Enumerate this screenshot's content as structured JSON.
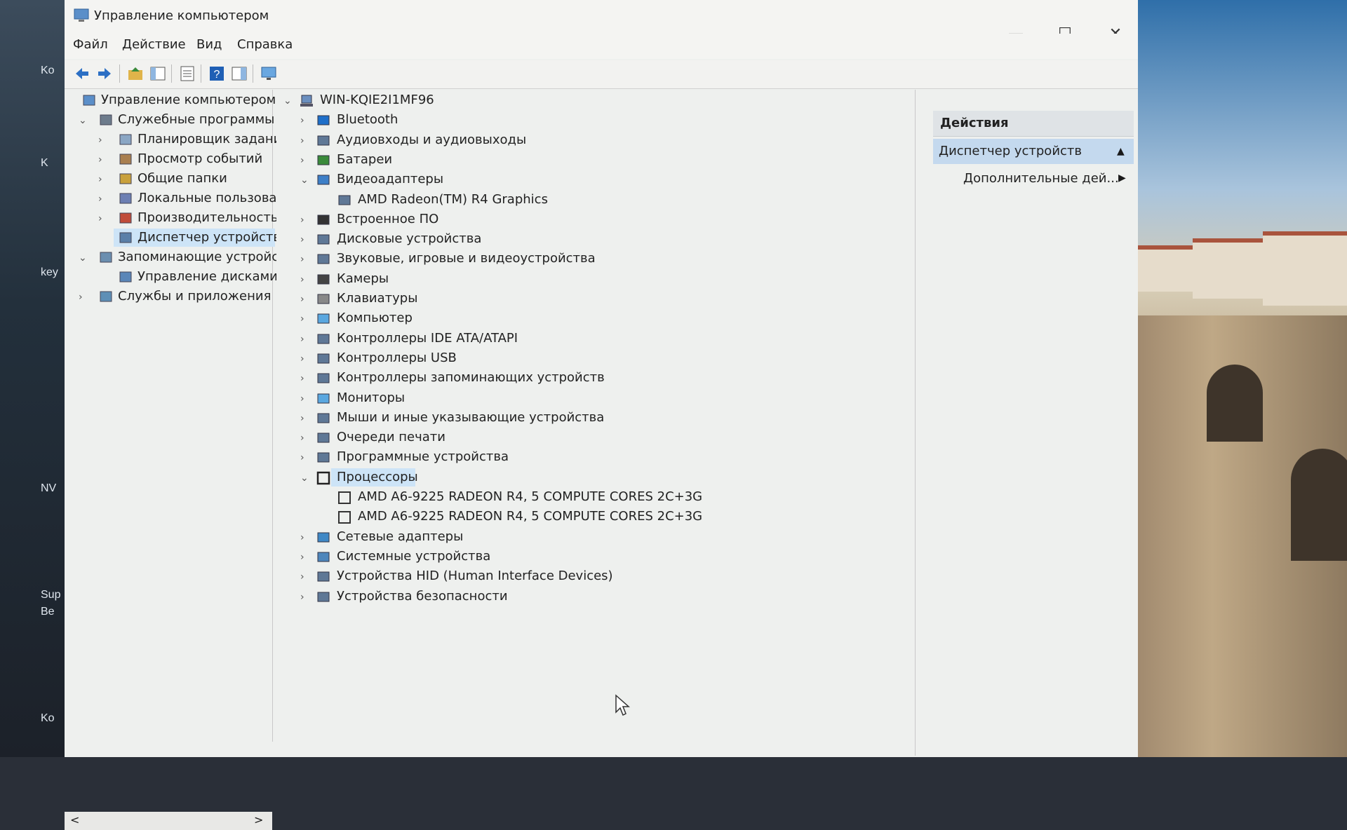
{
  "window": {
    "title": "Управление компьютером",
    "minimize": "—",
    "maximize": "☐",
    "close": "✕"
  },
  "menu": [
    "Файл",
    "Действие",
    "Вид",
    "Справка"
  ],
  "desktop_labels": [
    "Ko",
    "K",
    "key",
    "NV",
    "Sup",
    "Be",
    "Ko"
  ],
  "left_tree": [
    {
      "label": "Управление компьютером (л",
      "level": 0,
      "chev": ""
    },
    {
      "label": "Служебные программы",
      "level": 1,
      "chev": "v"
    },
    {
      "label": "Планировщик заданий",
      "level": 2,
      "chev": ">"
    },
    {
      "label": "Просмотр событий",
      "level": 2,
      "chev": ">"
    },
    {
      "label": "Общие папки",
      "level": 2,
      "chev": ">"
    },
    {
      "label": "Локальные пользовате",
      "level": 2,
      "chev": ">"
    },
    {
      "label": "Производительность",
      "level": 2,
      "chev": ">"
    },
    {
      "label": "Диспетчер устройств",
      "level": 2,
      "chev": "",
      "selected": true
    },
    {
      "label": "Запоминающие устройст",
      "level": 1,
      "chev": "v"
    },
    {
      "label": "Управление дисками",
      "level": 2,
      "chev": ""
    },
    {
      "label": "Службы и приложения",
      "level": 1,
      "chev": ">"
    }
  ],
  "device_tree": {
    "root": "WIN-KQIE2I1MF96",
    "items": [
      {
        "label": "Bluetooth",
        "chev": ">",
        "indent": 1
      },
      {
        "label": "Аудиовходы и аудиовыходы",
        "chev": ">",
        "indent": 1
      },
      {
        "label": "Батареи",
        "chev": ">",
        "indent": 1
      },
      {
        "label": "Видеоадаптеры",
        "chev": "v",
        "indent": 1
      },
      {
        "label": "AMD Radeon(TM) R4 Graphics",
        "chev": "",
        "indent": 2
      },
      {
        "label": "Встроенное ПО",
        "chev": ">",
        "indent": 1
      },
      {
        "label": "Дисковые устройства",
        "chev": ">",
        "indent": 1
      },
      {
        "label": "Звуковые, игровые и видеоустройства",
        "chev": ">",
        "indent": 1
      },
      {
        "label": "Камеры",
        "chev": ">",
        "indent": 1
      },
      {
        "label": "Клавиатуры",
        "chev": ">",
        "indent": 1
      },
      {
        "label": "Компьютер",
        "chev": ">",
        "indent": 1
      },
      {
        "label": "Контроллеры IDE ATA/ATAPI",
        "chev": ">",
        "indent": 1
      },
      {
        "label": "Контроллеры USB",
        "chev": ">",
        "indent": 1
      },
      {
        "label": "Контроллеры запоминающих устройств",
        "chev": ">",
        "indent": 1
      },
      {
        "label": "Мониторы",
        "chev": ">",
        "indent": 1
      },
      {
        "label": "Мыши и иные указывающие устройства",
        "chev": ">",
        "indent": 1
      },
      {
        "label": "Очереди печати",
        "chev": ">",
        "indent": 1
      },
      {
        "label": "Программные устройства",
        "chev": ">",
        "indent": 1
      },
      {
        "label": "Процессоры",
        "chev": "v",
        "indent": 1,
        "selected": true
      },
      {
        "label": "AMD A6-9225 RADEON R4, 5 COMPUTE CORES 2C+3G",
        "chev": "",
        "indent": 2
      },
      {
        "label": "AMD A6-9225 RADEON R4, 5 COMPUTE CORES 2C+3G",
        "chev": "",
        "indent": 2
      },
      {
        "label": "Сетевые адаптеры",
        "chev": ">",
        "indent": 1
      },
      {
        "label": "Системные устройства",
        "chev": ">",
        "indent": 1
      },
      {
        "label": "Устройства HID (Human Interface Devices)",
        "chev": ">",
        "indent": 1
      },
      {
        "label": "Устройства безопасности",
        "chev": ">",
        "indent": 1
      }
    ]
  },
  "actions": {
    "header": "Действия",
    "section": "Диспетчер устройств",
    "more": "Дополнительные дей...",
    "section_arrow": "▲",
    "more_arrow": "▶"
  },
  "scroll": {
    "left": "<",
    "right": ">"
  },
  "colors": {
    "selection": "#cde4f7",
    "actions_band": "#c4d9ee",
    "accent_blue": "#1e6fc9"
  }
}
